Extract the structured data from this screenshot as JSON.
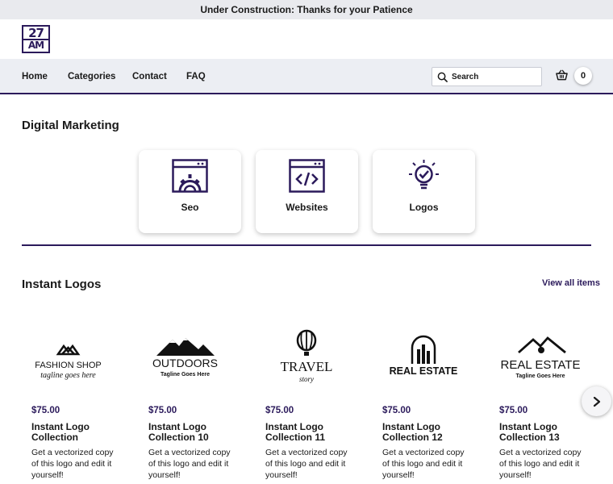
{
  "banner": {
    "text": "Under Construction: Thanks for your Patience"
  },
  "logo": {
    "line1": "27",
    "line2": "AM"
  },
  "nav": {
    "items": [
      "Home",
      "Categories",
      "Contact",
      "FAQ"
    ]
  },
  "search": {
    "placeholder": "Search"
  },
  "cart": {
    "count": "0"
  },
  "digital_marketing": {
    "title": "Digital Marketing",
    "cards": [
      {
        "label": "Seo",
        "icon": "gear-browser-icon"
      },
      {
        "label": "Websites",
        "icon": "code-browser-icon"
      },
      {
        "label": "Logos",
        "icon": "lightbulb-icon"
      }
    ]
  },
  "instant_logos": {
    "title": "Instant Logos",
    "view_all": "View all items",
    "products": [
      {
        "price": "$75.00",
        "title": "Instant Logo Collection",
        "desc": "Get a vectorized copy of this logo and edit it yourself!",
        "logo_main": "FASHION SHOP",
        "logo_sub": "tagline goes here"
      },
      {
        "price": "$75.00",
        "title": "Instant Logo Collection 10",
        "desc": "Get a vectorized copy of this logo and edit it yourself!",
        "logo_main": "OUTDOORS",
        "logo_sub": "Tagline Goes Here"
      },
      {
        "price": "$75.00",
        "title": "Instant Logo Collection 11",
        "desc": "Get a vectorized copy of this logo and edit it yourself!",
        "logo_main": "TRAVEL",
        "logo_sub": "story"
      },
      {
        "price": "$75.00",
        "title": "Instant Logo Collection 12",
        "desc": "Get a vectorized copy of this logo and edit it yourself!",
        "logo_main": "REAL ESTATE",
        "logo_sub": ""
      },
      {
        "price": "$75.00",
        "title": "Instant Logo Collection 13",
        "desc": "Get a vectorized copy of this logo and edit it yourself!",
        "logo_main": "REAL ESTATE",
        "logo_sub": "Tagline Goes Here"
      }
    ]
  },
  "colors": {
    "brand": "#2b1a5b",
    "nav_bg": "#eceef3",
    "banner_bg": "#e9eaee"
  }
}
